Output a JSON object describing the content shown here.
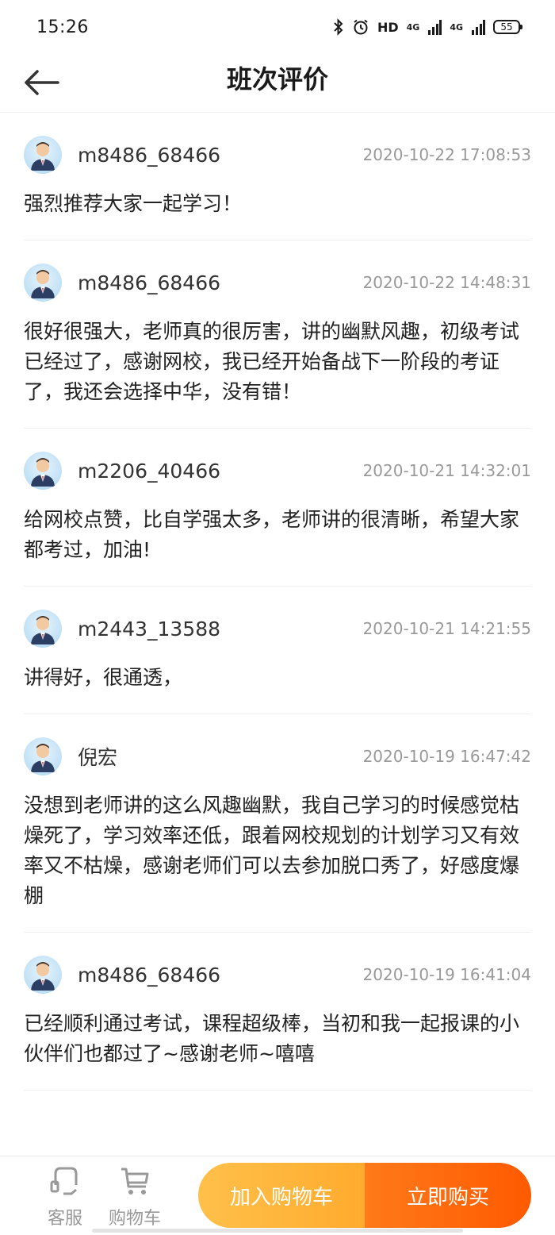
{
  "status_bar": {
    "time": "15:26",
    "hd_label": "HD",
    "network_1": "4G",
    "network_2": "4G",
    "battery": "55"
  },
  "header": {
    "title": "班次评价"
  },
  "reviews": [
    {
      "username": "m8486_68466",
      "time": "2020-10-22 17:08:53",
      "content": "强烈推荐大家一起学习！"
    },
    {
      "username": "m8486_68466",
      "time": "2020-10-22 14:48:31",
      "content": "很好很强大，老师真的很厉害，讲的幽默风趣，初级考试已经过了，感谢网校，我已经开始备战下一阶段的考证了，我还会选择中华，没有错！"
    },
    {
      "username": "m2206_40466",
      "time": "2020-10-21 14:32:01",
      "content": "给网校点赞，比自学强太多，老师讲的很清晰，希望大家都考过，加油!"
    },
    {
      "username": "m2443_13588",
      "time": "2020-10-21 14:21:55",
      "content": "讲得好，很通透，"
    },
    {
      "username": "倪宏",
      "time": "2020-10-19 16:47:42",
      "content": "没想到老师讲的这么风趣幽默，我自己学习的时候感觉枯燥死了，学习效率还低，跟着网校规划的计划学习又有效率又不枯燥，感谢老师们可以去参加脱口秀了，好感度爆棚"
    },
    {
      "username": "m8486_68466",
      "time": "2020-10-19 16:41:04",
      "content": "已经顺利通过考试，课程超级棒，当初和我一起报课的小伙伴们也都过了~感谢老师~嘻嘻"
    }
  ],
  "bottom_bar": {
    "service_label": "客服",
    "cart_label": "购物车",
    "add_cart_label": "加入购物车",
    "buy_now_label": "立即购买"
  },
  "colors": {
    "accent_orange": "#ff6a0a",
    "accent_yellow": "#ffb63a",
    "muted_text": "#999999"
  }
}
